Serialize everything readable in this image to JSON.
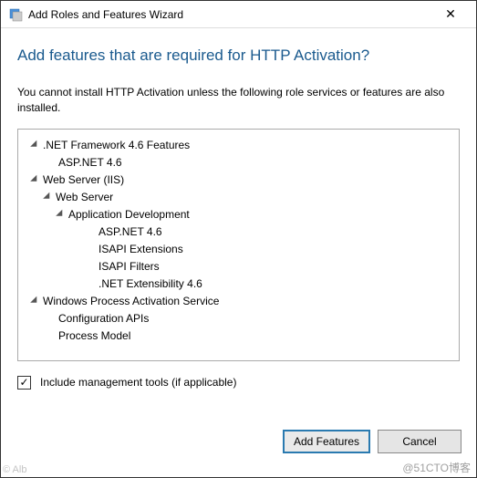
{
  "titlebar": {
    "title": "Add Roles and Features Wizard",
    "close": "✕"
  },
  "heading": "Add features that are required for HTTP Activation?",
  "description": "You cannot install HTTP Activation unless the following role services or features are also installed.",
  "tree": [
    {
      "label": ".NET Framework 4.6 Features",
      "indent": "indent-0",
      "expander": true
    },
    {
      "label": "ASP.NET 4.6",
      "indent": "indent-1",
      "expander": false
    },
    {
      "label": "Web Server (IIS)",
      "indent": "indent-0",
      "expander": true
    },
    {
      "label": "Web Server",
      "indent": "indent-1-tree",
      "expander": true
    },
    {
      "label": "Application Development",
      "indent": "indent-2-tree",
      "expander": true
    },
    {
      "label": "ASP.NET 4.6",
      "indent": "indent-4",
      "expander": false
    },
    {
      "label": "ISAPI Extensions",
      "indent": "indent-4",
      "expander": false
    },
    {
      "label": "ISAPI Filters",
      "indent": "indent-4",
      "expander": false
    },
    {
      "label": ".NET Extensibility 4.6",
      "indent": "indent-4",
      "expander": false
    },
    {
      "label": "Windows Process Activation Service",
      "indent": "indent-0",
      "expander": true
    },
    {
      "label": "Configuration APIs",
      "indent": "indent-1",
      "expander": false
    },
    {
      "label": "Process Model",
      "indent": "indent-1",
      "expander": false
    }
  ],
  "checkbox": {
    "checked": "✓",
    "label": "Include management tools (if applicable)"
  },
  "buttons": {
    "add": "Add Features",
    "cancel": "Cancel"
  },
  "watermark": "@51CTO博客",
  "watermark_left": "© Alb"
}
